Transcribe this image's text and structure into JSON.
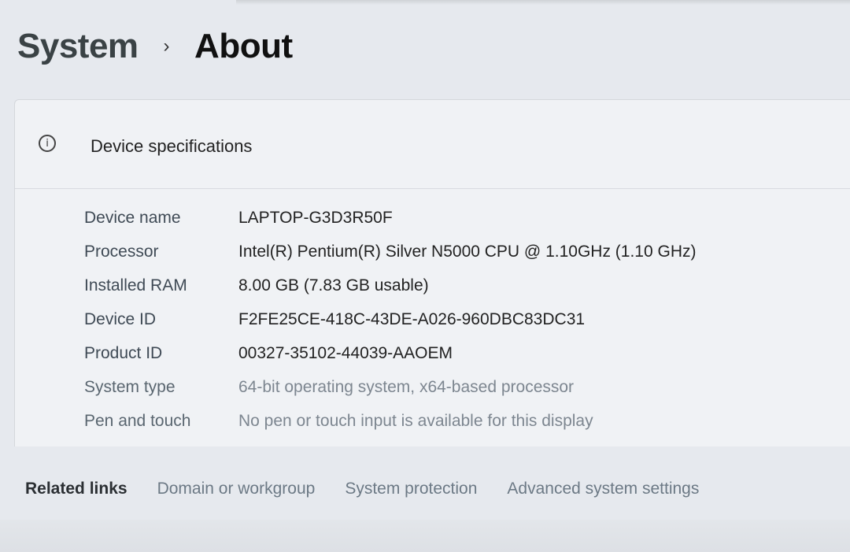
{
  "breadcrumb": {
    "parent": "System",
    "separator": "›",
    "current": "About"
  },
  "device_specifications": {
    "icon": "info-icon",
    "title": "Device specifications",
    "rows": [
      {
        "label": "Device name",
        "value": "LAPTOP-G3D3R50F"
      },
      {
        "label": "Processor",
        "value": "Intel(R) Pentium(R) Silver N5000 CPU @ 1.10GHz (1.10 GHz)"
      },
      {
        "label": "Installed RAM",
        "value": "8.00 GB (7.83 GB usable)"
      },
      {
        "label": "Device ID",
        "value": "F2FE25CE-418C-43DE-A026-960DBC83DC31"
      },
      {
        "label": "Product ID",
        "value": "00327-35102-44039-AAOEM"
      },
      {
        "label": "System type",
        "value": "64-bit operating system, x64-based processor"
      },
      {
        "label": "Pen and touch",
        "value": "No pen or touch input is available for this display"
      }
    ]
  },
  "related_links": {
    "title": "Related links",
    "links": [
      "Domain or workgroup",
      "System protection",
      "Advanced system settings"
    ]
  }
}
